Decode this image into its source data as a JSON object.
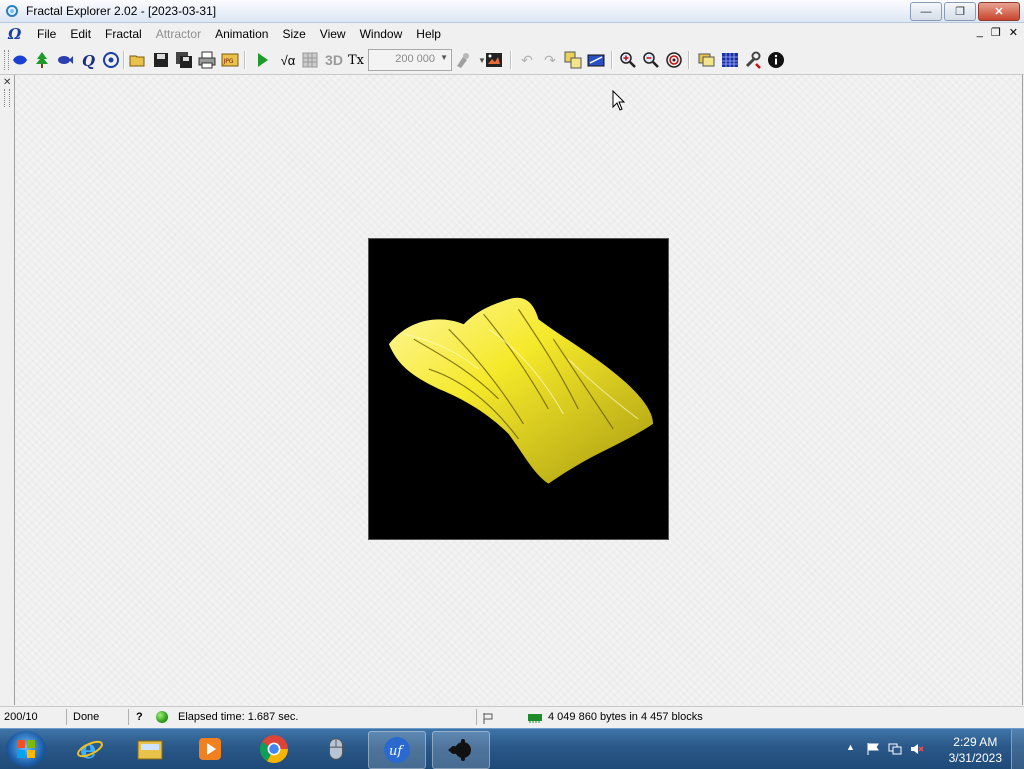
{
  "window": {
    "title": "Fractal Explorer 2.02  - [2023-03-31]",
    "minimize_glyph": "—",
    "restore_glyph": "❐",
    "close_glyph": "✕"
  },
  "menu": {
    "doc_icon": "Ω",
    "items": [
      "File",
      "Edit",
      "Fractal",
      "Attractor",
      "Animation",
      "Size",
      "View",
      "Window",
      "Help"
    ],
    "mdi_minimize": "_",
    "mdi_restore": "❐",
    "mdi_close": "✕"
  },
  "toolbar": {
    "iterations_value": "200 000",
    "label_3d": "3D",
    "label_tx": "Tx",
    "label_sqrt": "√α",
    "icons": [
      "julia-set-icon",
      "tree-icon",
      "fish-icon",
      "quaternion-icon",
      "target-icon",
      "open-folder-icon",
      "save-icon",
      "save-all-icon",
      "print-icon",
      "jpg-icon",
      "run-icon",
      "formula-icon",
      "grid-icon",
      "3d-icon",
      "texture-icon",
      "iterations-combo",
      "brush-icon",
      "image-icon",
      "undo-icon",
      "redo-icon",
      "copy-icon",
      "resize-icon",
      "zoom-in-icon",
      "zoom-out-icon",
      "fit-icon",
      "layers-icon",
      "palette-icon",
      "tools-icon",
      "info-icon"
    ]
  },
  "left_gutter": {
    "close_glyph": "✕"
  },
  "status": {
    "position": "200/10",
    "state": "Done",
    "help": "?",
    "elapsed": "Elapsed time: 1.687 sec.",
    "memory": "4 049 860 bytes in 4 457 blocks"
  },
  "taskbar": {
    "apps": [
      "internet-explorer",
      "file-explorer",
      "media-player",
      "chrome",
      "mouse-tool",
      "ultra-fractal",
      "fractal-explorer"
    ],
    "time": "2:29 AM",
    "date": "3/31/2023"
  },
  "colors": {
    "fractal_yellow": "#f5e92a",
    "canvas_bg": "#000000",
    "title_gradient_top": "#fbfcfe",
    "taskbar": "#2a5888"
  }
}
